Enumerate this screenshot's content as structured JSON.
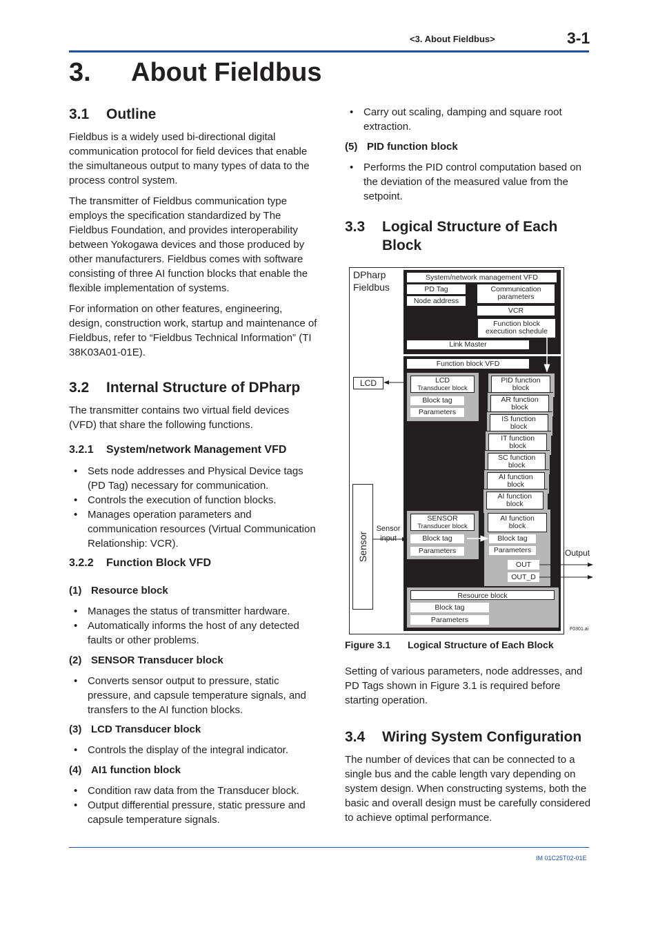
{
  "header": {
    "section": "<3.  About Fieldbus>",
    "page_number": "3-1"
  },
  "chapter": {
    "number": "3.",
    "title": "About Fieldbus"
  },
  "s31": {
    "number": "3.1",
    "title": "Outline",
    "paragraphs": [
      "Fieldbus is a widely used bi-directional digital communication protocol for field devices that enable the simultaneous output to many types of data to the process control system.",
      "The transmitter of Fieldbus communication type employs the specification standardized by The Fieldbus Foundation, and provides interoperability between Yokogawa devices and those produced by other manufacturers. Fieldbus comes with software consisting of three AI function blocks that enable the flexible implementation of systems.",
      "For information on other features, engineering, design, construction work, startup and maintenance of Fieldbus, refer to “Fieldbus Technical Information” (TI 38K03A01-01E)."
    ]
  },
  "s32": {
    "number": "3.2",
    "title": "Internal Structure of DPharp",
    "intro": "The transmitter contains two virtual field devices (VFD) that share the following functions.",
    "s321": {
      "number": "3.2.1",
      "title": "System/network Management VFD",
      "bullets": [
        "Sets node addresses and Physical Device tags (PD Tag) necessary for communication.",
        "Controls the execution of function blocks.",
        "Manages operation parameters and communication resources (Virtual Communication Relationship: VCR)."
      ]
    },
    "s322": {
      "number": "3.2.2",
      "title": "Function Block VFD",
      "items": [
        {
          "number": "(1)",
          "title": "Resource block",
          "bullets": [
            "Manages the status of transmitter hardware.",
            "Automatically informs the host of any detected faults or other problems."
          ]
        },
        {
          "number": "(2)",
          "title": "SENSOR Transducer block",
          "bullets": [
            "Converts sensor output to pressure, static pressure, and capsule temperature signals, and transfers to the AI function blocks."
          ]
        },
        {
          "number": "(3)",
          "title": "LCD Transducer block",
          "bullets": [
            "Controls the display of the integral indicator."
          ]
        },
        {
          "number": "(4)",
          "title": "AI1 function block",
          "bullets": [
            "Condition raw data from the Transducer block.",
            "Output differential pressure, static pressure and capsule temperature signals.",
            "Carry out scaling, damping and square root extraction."
          ]
        },
        {
          "number": "(5)",
          "title": "PID function block",
          "bullets": [
            "Performs the PID control computation based on the deviation of the measured value from the setpoint."
          ]
        }
      ]
    }
  },
  "s33": {
    "number": "3.3",
    "title_line1": "Logical Structure of Each",
    "title_line2": "Block",
    "after_text": "Setting of various parameters, node addresses, and PD Tags shown in Figure 3.1 is required before starting operation."
  },
  "figure": {
    "device_label_1": "DPharp",
    "device_label_2": "Fieldbus",
    "sysnet_title": "System/network management VFD",
    "pd_tag": "PD Tag",
    "node_address": "Node address",
    "comm_params_1": "Communication",
    "comm_params_2": "parameters",
    "vcr": "VCR",
    "fb_sched_1": "Function block",
    "fb_sched_2": "execution schedule",
    "link_master": "Link Master",
    "fb_vfd": "Function block VFD",
    "lcd": "LCD",
    "lcd_tb_1": "LCD",
    "lcd_tb_2": "Transducer block",
    "block_tag": "Block tag",
    "parameters": "Parameters",
    "fn_blocks": [
      {
        "l1": "PID function",
        "l2": "block"
      },
      {
        "l1": "AR function",
        "l2": "block"
      },
      {
        "l1": "IS function",
        "l2": "block"
      },
      {
        "l1": "IT function",
        "l2": "block"
      },
      {
        "l1": "SC function",
        "l2": "block"
      },
      {
        "l1": "AI function",
        "l2": "block"
      },
      {
        "l1": "AI function",
        "l2": "block"
      }
    ],
    "ai_main_1": "AI function",
    "ai_main_2": "block",
    "sensor": "Sensor",
    "sensor_input_1": "Sensor",
    "sensor_input_2": "input",
    "sensor_tb_1": "SENSOR",
    "sensor_tb_2": "Transducer block",
    "out": "OUT",
    "out_d": "OUT_D",
    "output": "Output",
    "resource_block": "Resource block",
    "file_id": "F0301.ai",
    "caption_number": "Figure 3.1",
    "caption_title": "Logical Structure of Each Block"
  },
  "s34": {
    "number": "3.4",
    "title": "Wiring System Configuration",
    "text": "The number of devices that can be connected to a single bus and the cable length vary depending on system design. When constructing systems, both the basic and overall design must be carefully considered to achieve optimal performance."
  },
  "footer": {
    "doc_number": "IM 01C25T02-01E"
  }
}
